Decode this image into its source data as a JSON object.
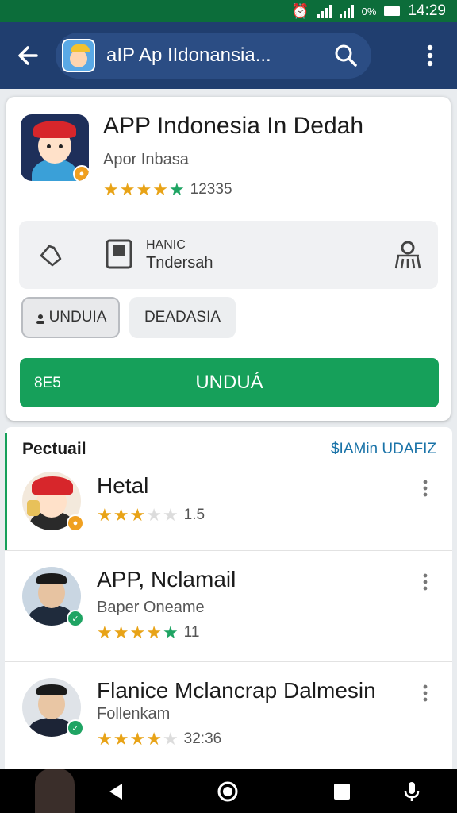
{
  "status_bar": {
    "battery_percent": "0%",
    "time": "14:29"
  },
  "app_bar": {
    "search_text": "aIP Ap IIdonansia...",
    "app_icon": "worker-app-icon"
  },
  "app": {
    "title": "APP Indonesia In Dedah",
    "developer": "Apor Inbasa",
    "rating": 4.5,
    "rating_count": "12335",
    "info": {
      "line1": "HANIC",
      "line2": "Tndersah"
    },
    "chips": {
      "chip1": "UNDUIA",
      "chip2": "DEADASIA"
    },
    "install": {
      "small_label": "8E5",
      "label": "UNDUÁ"
    },
    "accent_color": "#16a05a"
  },
  "related": {
    "heading": "Pectuail",
    "link": "$IAMin UDAFIZ",
    "items": [
      {
        "title": "Hetal",
        "subtitle": "",
        "rating": 3,
        "rating_text": "1.5"
      },
      {
        "title": "APP, Nclamail",
        "subtitle": "Baper Oneame",
        "rating": 5,
        "rating_text": "11"
      },
      {
        "title": "Flanice Mclancrap Dalmesin",
        "subtitle": "Follenkam",
        "rating": 4,
        "rating_text": "32:36"
      }
    ]
  },
  "nav": {
    "icons": [
      "back-triangle-icon",
      "home-circle-icon",
      "recents-square-icon",
      "mic-icon"
    ]
  }
}
